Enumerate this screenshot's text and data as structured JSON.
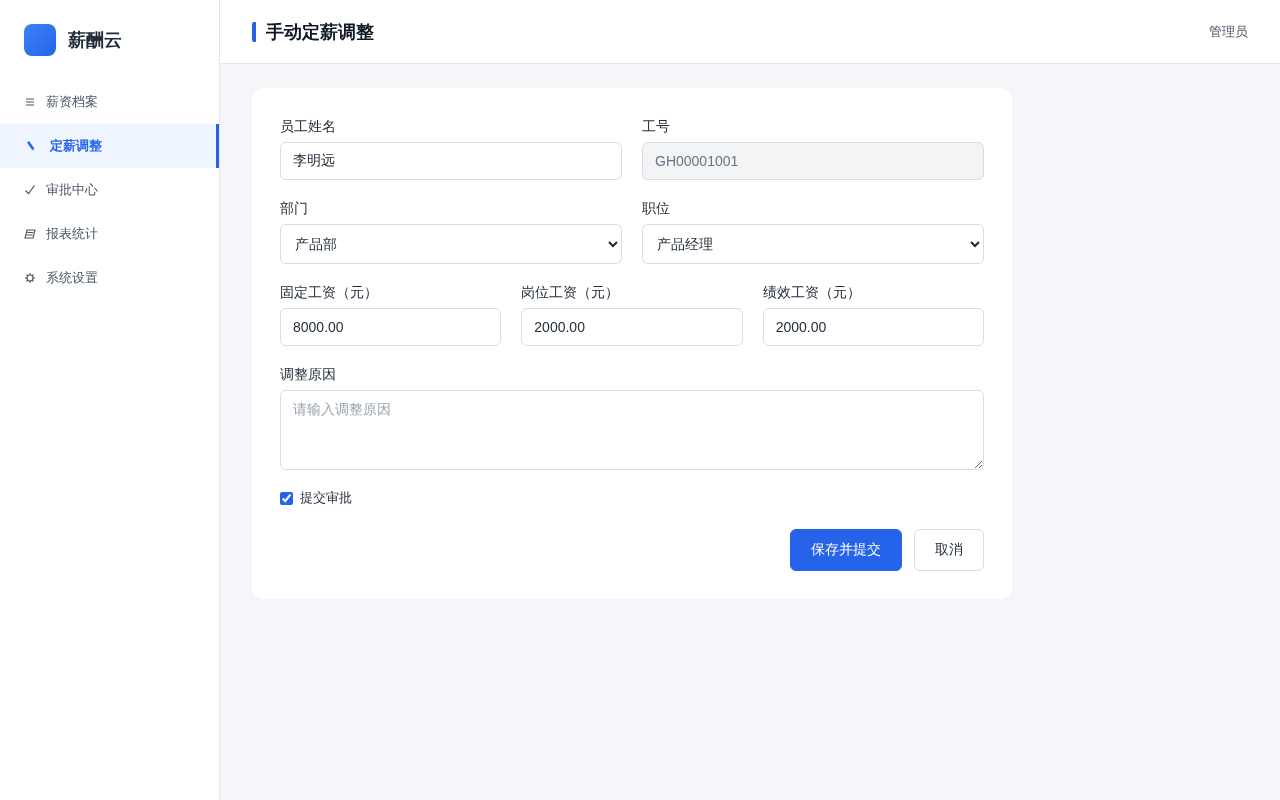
{
  "sidebar": {
    "logo_text": "薪酬云",
    "items": [
      {
        "label": "薪资档案",
        "selected": false
      },
      {
        "label": "定薪调整",
        "selected": true
      },
      {
        "label": "审批中心",
        "selected": false
      },
      {
        "label": "报表统计",
        "selected": false
      },
      {
        "label": "系统设置",
        "selected": false
      }
    ]
  },
  "header": {
    "title": "手动定薪调整",
    "user": "管理员"
  },
  "form": {
    "rows": [
      [
        {
          "kind": "input",
          "label": "员工姓名",
          "value": "李明远",
          "disabled": false
        },
        {
          "kind": "input",
          "label": "工号",
          "value": "GH00001001",
          "disabled": true
        }
      ],
      [
        {
          "kind": "select",
          "label": "部门",
          "value": "产品部",
          "disabled": false
        },
        {
          "kind": "select",
          "label": "职位",
          "value": "产品经理",
          "disabled": false
        }
      ],
      [
        {
          "kind": "input",
          "label": "固定工资（元）",
          "value": "8000.00",
          "disabled": false
        },
        {
          "kind": "input",
          "label": "岗位工资（元）",
          "value": "2000.00",
          "disabled": false
        },
        {
          "kind": "input",
          "label": "绩效工资（元）",
          "value": "2000.00",
          "disabled": false
        }
      ]
    ],
    "reason": {
      "label": "调整原因",
      "placeholder": "请输入调整原因"
    },
    "submit_for_approval": {
      "label": "提交审批",
      "checked": true
    },
    "buttons": [
      {
        "label": "保存并提交",
        "kind": "primary"
      },
      {
        "label": "取消",
        "kind": "default"
      }
    ]
  }
}
